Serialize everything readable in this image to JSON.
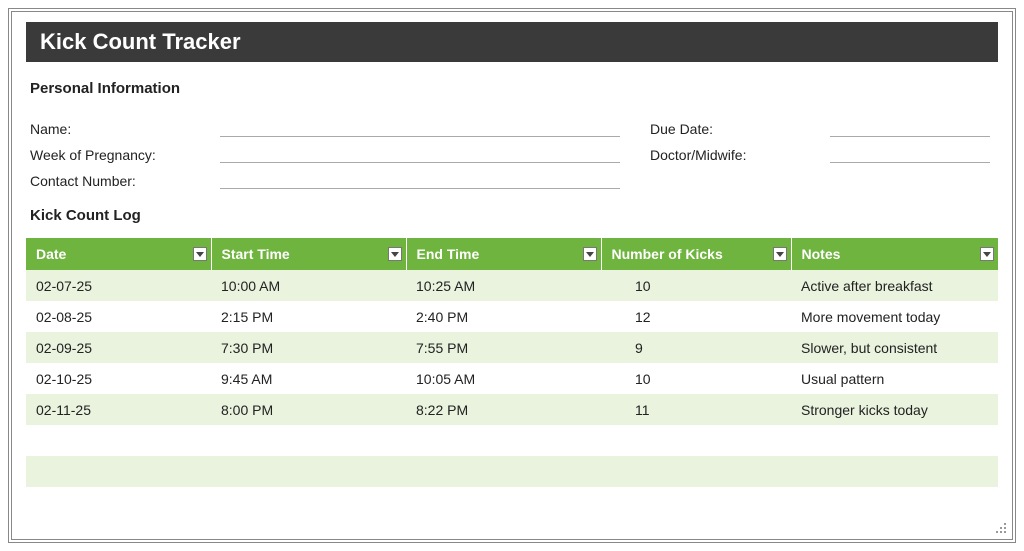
{
  "title": "Kick Count Tracker",
  "sections": {
    "personal": "Personal Information",
    "log": "Kick Count Log"
  },
  "info_labels": {
    "name": "Name:",
    "week": "Week of Pregnancy:",
    "contact": "Contact Number:",
    "due": "Due Date:",
    "doctor": "Doctor/Midwife:"
  },
  "columns": {
    "date": "Date",
    "start": "Start Time",
    "end": "End Time",
    "kicks": "Number of Kicks",
    "notes": "Notes"
  },
  "rows": [
    {
      "date": "02-07-25",
      "start": "10:00 AM",
      "end": "10:25 AM",
      "kicks": "10",
      "notes": "Active after breakfast"
    },
    {
      "date": "02-08-25",
      "start": "2:15 PM",
      "end": "2:40 PM",
      "kicks": "12",
      "notes": "More movement today"
    },
    {
      "date": "02-09-25",
      "start": "7:30 PM",
      "end": "7:55 PM",
      "kicks": "9",
      "notes": "Slower, but consistent"
    },
    {
      "date": "02-10-25",
      "start": "9:45 AM",
      "end": "10:05 AM",
      "kicks": "10",
      "notes": "Usual pattern"
    },
    {
      "date": "02-11-25",
      "start": "8:00 PM",
      "end": "8:22 PM",
      "kicks": "11",
      "notes": "Stronger kicks today"
    },
    {
      "date": "",
      "start": "",
      "end": "",
      "kicks": "",
      "notes": ""
    },
    {
      "date": "",
      "start": "",
      "end": "",
      "kicks": "",
      "notes": ""
    },
    {
      "date": "",
      "start": "",
      "end": "",
      "kicks": "",
      "notes": ""
    }
  ]
}
